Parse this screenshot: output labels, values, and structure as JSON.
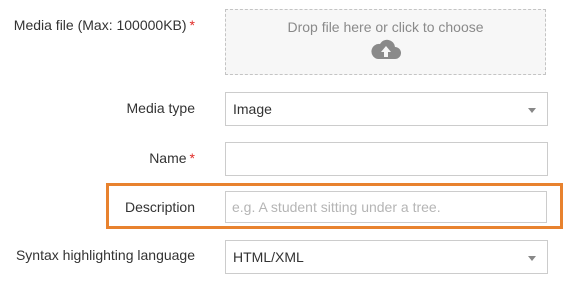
{
  "media_file": {
    "label": "Media file (Max: 100000KB)",
    "required_mark": "*",
    "dropzone_text": "Drop file here or click to choose"
  },
  "media_type": {
    "label": "Media type",
    "value": "Image"
  },
  "name": {
    "label": "Name",
    "required_mark": "*",
    "value": ""
  },
  "description": {
    "label": "Description",
    "value": "",
    "placeholder": "e.g. A student sitting under a tree."
  },
  "syntax": {
    "label": "Syntax highlighting language",
    "value": "HTML/XML"
  },
  "colors": {
    "highlight": "#e8822e",
    "required": "#e02b27"
  },
  "icons": {
    "upload": "cloud-upload-icon",
    "dropdown": "chevron-down-icon"
  }
}
